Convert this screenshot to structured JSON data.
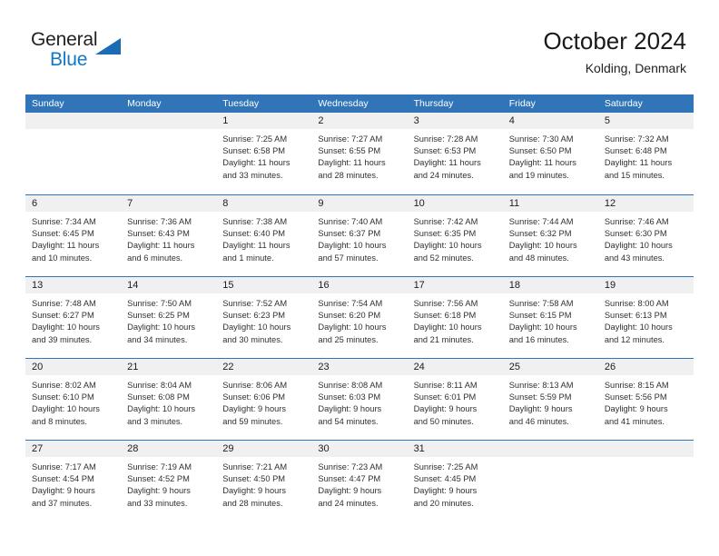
{
  "brand": {
    "name_part1": "General",
    "name_part2": "Blue",
    "triangle_color": "#1b6cb5",
    "blue_text_color": "#1277c4"
  },
  "header": {
    "title": "October 2024",
    "subtitle": "Kolding, Denmark"
  },
  "theme": {
    "header_bar_color": "#3175b8",
    "date_strip_color": "#f0f0f0",
    "row_divider_color": "#3175b8",
    "text_color": "#303030"
  },
  "weekdays": [
    "Sunday",
    "Monday",
    "Tuesday",
    "Wednesday",
    "Thursday",
    "Friday",
    "Saturday"
  ],
  "weeks": [
    [
      {
        "day": "",
        "empty": true
      },
      {
        "day": "",
        "empty": true
      },
      {
        "day": "1",
        "sunrise": "Sunrise: 7:25 AM",
        "sunset": "Sunset: 6:58 PM",
        "daylight1": "Daylight: 11 hours",
        "daylight2": "and 33 minutes."
      },
      {
        "day": "2",
        "sunrise": "Sunrise: 7:27 AM",
        "sunset": "Sunset: 6:55 PM",
        "daylight1": "Daylight: 11 hours",
        "daylight2": "and 28 minutes."
      },
      {
        "day": "3",
        "sunrise": "Sunrise: 7:28 AM",
        "sunset": "Sunset: 6:53 PM",
        "daylight1": "Daylight: 11 hours",
        "daylight2": "and 24 minutes."
      },
      {
        "day": "4",
        "sunrise": "Sunrise: 7:30 AM",
        "sunset": "Sunset: 6:50 PM",
        "daylight1": "Daylight: 11 hours",
        "daylight2": "and 19 minutes."
      },
      {
        "day": "5",
        "sunrise": "Sunrise: 7:32 AM",
        "sunset": "Sunset: 6:48 PM",
        "daylight1": "Daylight: 11 hours",
        "daylight2": "and 15 minutes."
      }
    ],
    [
      {
        "day": "6",
        "sunrise": "Sunrise: 7:34 AM",
        "sunset": "Sunset: 6:45 PM",
        "daylight1": "Daylight: 11 hours",
        "daylight2": "and 10 minutes."
      },
      {
        "day": "7",
        "sunrise": "Sunrise: 7:36 AM",
        "sunset": "Sunset: 6:43 PM",
        "daylight1": "Daylight: 11 hours",
        "daylight2": "and 6 minutes."
      },
      {
        "day": "8",
        "sunrise": "Sunrise: 7:38 AM",
        "sunset": "Sunset: 6:40 PM",
        "daylight1": "Daylight: 11 hours",
        "daylight2": "and 1 minute."
      },
      {
        "day": "9",
        "sunrise": "Sunrise: 7:40 AM",
        "sunset": "Sunset: 6:37 PM",
        "daylight1": "Daylight: 10 hours",
        "daylight2": "and 57 minutes."
      },
      {
        "day": "10",
        "sunrise": "Sunrise: 7:42 AM",
        "sunset": "Sunset: 6:35 PM",
        "daylight1": "Daylight: 10 hours",
        "daylight2": "and 52 minutes."
      },
      {
        "day": "11",
        "sunrise": "Sunrise: 7:44 AM",
        "sunset": "Sunset: 6:32 PM",
        "daylight1": "Daylight: 10 hours",
        "daylight2": "and 48 minutes."
      },
      {
        "day": "12",
        "sunrise": "Sunrise: 7:46 AM",
        "sunset": "Sunset: 6:30 PM",
        "daylight1": "Daylight: 10 hours",
        "daylight2": "and 43 minutes."
      }
    ],
    [
      {
        "day": "13",
        "sunrise": "Sunrise: 7:48 AM",
        "sunset": "Sunset: 6:27 PM",
        "daylight1": "Daylight: 10 hours",
        "daylight2": "and 39 minutes."
      },
      {
        "day": "14",
        "sunrise": "Sunrise: 7:50 AM",
        "sunset": "Sunset: 6:25 PM",
        "daylight1": "Daylight: 10 hours",
        "daylight2": "and 34 minutes."
      },
      {
        "day": "15",
        "sunrise": "Sunrise: 7:52 AM",
        "sunset": "Sunset: 6:23 PM",
        "daylight1": "Daylight: 10 hours",
        "daylight2": "and 30 minutes."
      },
      {
        "day": "16",
        "sunrise": "Sunrise: 7:54 AM",
        "sunset": "Sunset: 6:20 PM",
        "daylight1": "Daylight: 10 hours",
        "daylight2": "and 25 minutes."
      },
      {
        "day": "17",
        "sunrise": "Sunrise: 7:56 AM",
        "sunset": "Sunset: 6:18 PM",
        "daylight1": "Daylight: 10 hours",
        "daylight2": "and 21 minutes."
      },
      {
        "day": "18",
        "sunrise": "Sunrise: 7:58 AM",
        "sunset": "Sunset: 6:15 PM",
        "daylight1": "Daylight: 10 hours",
        "daylight2": "and 16 minutes."
      },
      {
        "day": "19",
        "sunrise": "Sunrise: 8:00 AM",
        "sunset": "Sunset: 6:13 PM",
        "daylight1": "Daylight: 10 hours",
        "daylight2": "and 12 minutes."
      }
    ],
    [
      {
        "day": "20",
        "sunrise": "Sunrise: 8:02 AM",
        "sunset": "Sunset: 6:10 PM",
        "daylight1": "Daylight: 10 hours",
        "daylight2": "and 8 minutes."
      },
      {
        "day": "21",
        "sunrise": "Sunrise: 8:04 AM",
        "sunset": "Sunset: 6:08 PM",
        "daylight1": "Daylight: 10 hours",
        "daylight2": "and 3 minutes."
      },
      {
        "day": "22",
        "sunrise": "Sunrise: 8:06 AM",
        "sunset": "Sunset: 6:06 PM",
        "daylight1": "Daylight: 9 hours",
        "daylight2": "and 59 minutes."
      },
      {
        "day": "23",
        "sunrise": "Sunrise: 8:08 AM",
        "sunset": "Sunset: 6:03 PM",
        "daylight1": "Daylight: 9 hours",
        "daylight2": "and 54 minutes."
      },
      {
        "day": "24",
        "sunrise": "Sunrise: 8:11 AM",
        "sunset": "Sunset: 6:01 PM",
        "daylight1": "Daylight: 9 hours",
        "daylight2": "and 50 minutes."
      },
      {
        "day": "25",
        "sunrise": "Sunrise: 8:13 AM",
        "sunset": "Sunset: 5:59 PM",
        "daylight1": "Daylight: 9 hours",
        "daylight2": "and 46 minutes."
      },
      {
        "day": "26",
        "sunrise": "Sunrise: 8:15 AM",
        "sunset": "Sunset: 5:56 PM",
        "daylight1": "Daylight: 9 hours",
        "daylight2": "and 41 minutes."
      }
    ],
    [
      {
        "day": "27",
        "sunrise": "Sunrise: 7:17 AM",
        "sunset": "Sunset: 4:54 PM",
        "daylight1": "Daylight: 9 hours",
        "daylight2": "and 37 minutes."
      },
      {
        "day": "28",
        "sunrise": "Sunrise: 7:19 AM",
        "sunset": "Sunset: 4:52 PM",
        "daylight1": "Daylight: 9 hours",
        "daylight2": "and 33 minutes."
      },
      {
        "day": "29",
        "sunrise": "Sunrise: 7:21 AM",
        "sunset": "Sunset: 4:50 PM",
        "daylight1": "Daylight: 9 hours",
        "daylight2": "and 28 minutes."
      },
      {
        "day": "30",
        "sunrise": "Sunrise: 7:23 AM",
        "sunset": "Sunset: 4:47 PM",
        "daylight1": "Daylight: 9 hours",
        "daylight2": "and 24 minutes."
      },
      {
        "day": "31",
        "sunrise": "Sunrise: 7:25 AM",
        "sunset": "Sunset: 4:45 PM",
        "daylight1": "Daylight: 9 hours",
        "daylight2": "and 20 minutes."
      },
      {
        "day": "",
        "empty": true
      },
      {
        "day": "",
        "empty": true
      }
    ]
  ]
}
